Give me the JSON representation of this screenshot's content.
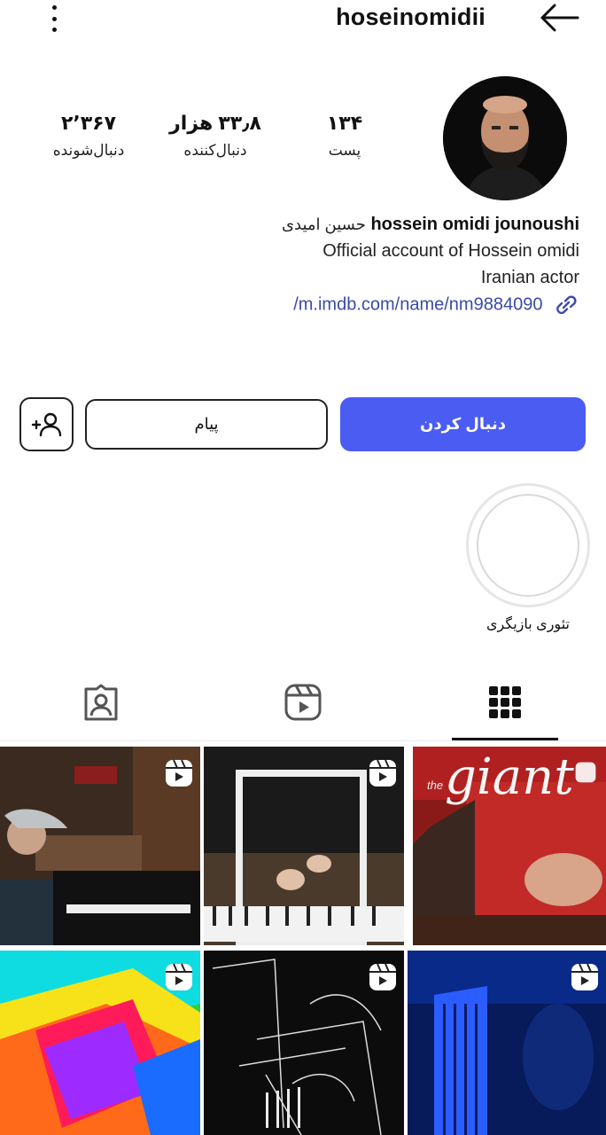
{
  "header": {
    "username": "hoseinomidii"
  },
  "stats": [
    {
      "value": "۱۳۴",
      "label": "پست"
    },
    {
      "value": "۳۳٫۸ هزار",
      "label": "دنبال‌کننده"
    },
    {
      "value": "۲٬۳۶۷",
      "label": "دنبال‌شونده"
    }
  ],
  "bio": {
    "full_name": "hossein omidi jounoushi",
    "persian_name": "حسین امیدی",
    "line1": "Official account of Hossein omidi",
    "line2": "Iranian actor",
    "link": "/m.imdb.com/name/nm9884090"
  },
  "buttons": {
    "follow": "دنبال کردن",
    "message": "پیام"
  },
  "highlight": {
    "label": "تئوری بازیگری"
  },
  "tabs": [
    "grid-tab",
    "reels-tab",
    "tagged-tab"
  ],
  "grid": {
    "poster_text": "giant",
    "poster_prefix": "the"
  },
  "colors": {
    "accent": "#4a5cf2",
    "link": "#3b4aa8"
  }
}
